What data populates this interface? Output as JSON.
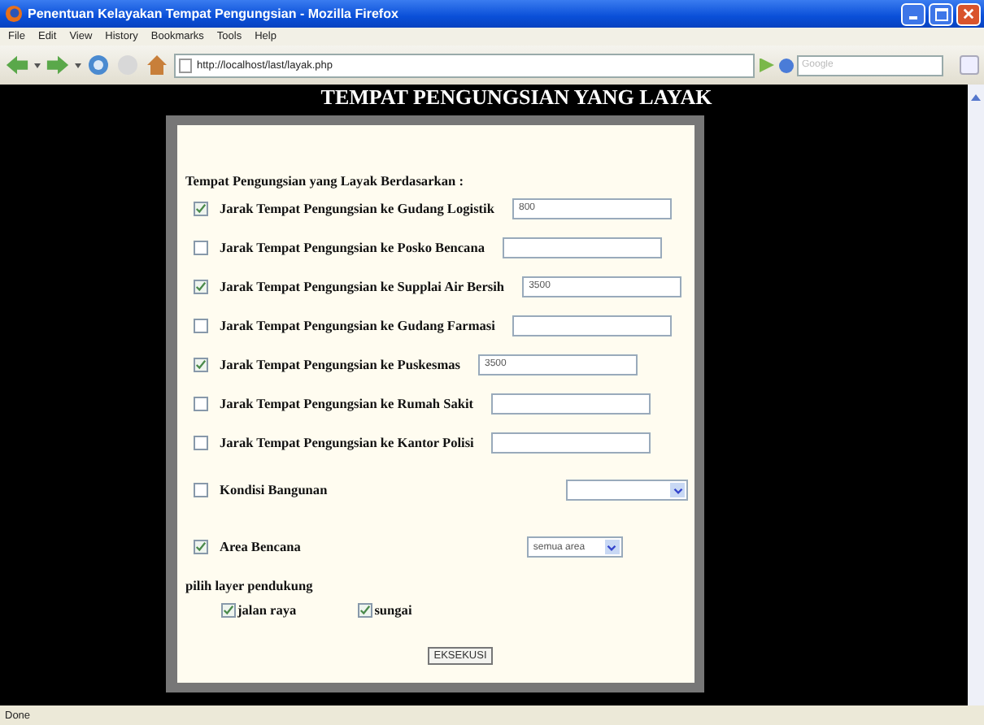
{
  "window": {
    "title": "Penentuan Kelayakan Tempat Pengungsian - Mozilla Firefox"
  },
  "menu": [
    "File",
    "Edit",
    "View",
    "History",
    "Bookmarks",
    "Tools",
    "Help"
  ],
  "address": {
    "value": "http://localhost/last/layak.php"
  },
  "search": {
    "placeholder": "Google"
  },
  "page": {
    "heading": "TEMPAT PENGUNGSIAN YANG LAYAK",
    "form_title": "Tempat Pengungsian yang Layak Berdasarkan :",
    "criteria": [
      {
        "kind": "text",
        "label": "Jarak Tempat Pengungsian ke Gudang Logistik",
        "checked": true,
        "value": "800"
      },
      {
        "kind": "text",
        "label": "Jarak Tempat Pengungsian ke Posko Bencana",
        "checked": false
      },
      {
        "kind": "text",
        "label": "Jarak Tempat Pengungsian ke Supplai Air Bersih",
        "checked": true,
        "value": "3500"
      },
      {
        "kind": "text",
        "label": "Jarak Tempat Pengungsian ke Gudang Farmasi",
        "checked": false
      },
      {
        "kind": "text",
        "label": "Jarak Tempat Pengungsian ke Puskesmas",
        "checked": true,
        "value": "3500"
      },
      {
        "kind": "text",
        "label": "Jarak Tempat Pengungsian ke Rumah Sakit",
        "checked": false
      },
      {
        "kind": "text",
        "label": "Jarak Tempat Pengungsian ke Kantor Polisi",
        "checked": false
      },
      {
        "kind": "select",
        "label": "Kondisi Bangunan",
        "checked": false
      },
      {
        "kind": "select",
        "label": "Area Bencana",
        "checked": true,
        "value": "semua area"
      }
    ],
    "layers_title": "pilih layer pendukung",
    "layers": [
      {
        "label": "jalan raya",
        "checked": true
      },
      {
        "label": "sungai",
        "checked": true
      }
    ],
    "button": "EKSEKUSI"
  },
  "status_bar": "Done"
}
